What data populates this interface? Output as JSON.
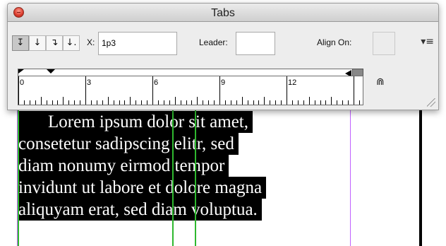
{
  "window": {
    "title": "Tabs"
  },
  "toolbar": {
    "tab_buttons": [
      {
        "glyph": "↧",
        "name": "left-justified-tab",
        "active": true
      },
      {
        "glyph": "↓",
        "name": "center-justified-tab",
        "active": false
      },
      {
        "glyph": "↴",
        "name": "right-justified-tab",
        "active": false
      },
      {
        "glyph": "↓.",
        "name": "align-to-decimal-tab",
        "active": false
      }
    ],
    "x_label": "X:",
    "x_value": "1p3",
    "leader_label": "Leader:",
    "leader_value": "",
    "align_on_label": "Align On:",
    "align_on_value": "",
    "menu_glyph": "▾≡"
  },
  "ruler": {
    "labels": [
      "0",
      "3",
      "6",
      "9",
      "12"
    ],
    "magnet_glyph": "⋒"
  },
  "document": {
    "lines": [
      "Lorem ipsum dolor sit amet,",
      "consetetur sadipscing elitr, sed",
      "diam nonumy eirmod tempor",
      "invidunt ut labore et dolore magna",
      "aliquyam erat, sed diam voluptua."
    ]
  },
  "colors": {
    "frame": "#c061ff",
    "guide": "#2fb82f",
    "selection": "#000000"
  }
}
